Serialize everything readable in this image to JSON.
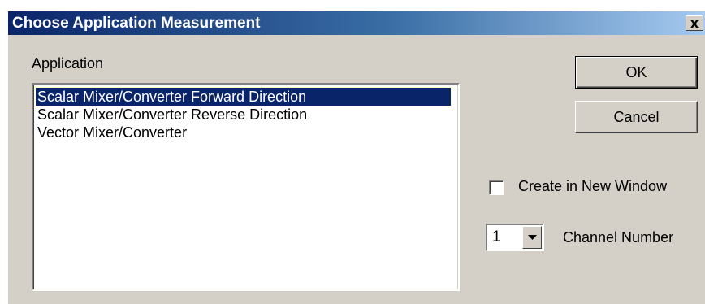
{
  "dialog": {
    "title": "Choose Application Measurement",
    "close_glyph": "x",
    "close_icon": "close-icon"
  },
  "application": {
    "label": "Application",
    "items": [
      "Scalar Mixer/Converter Forward Direction",
      "Scalar Mixer/Converter Reverse Direction",
      "Vector Mixer/Converter"
    ],
    "selected_index": 0
  },
  "buttons": {
    "ok": "OK",
    "cancel": "Cancel"
  },
  "options": {
    "create_new_window_label": "Create in New Window",
    "create_new_window_checked": false,
    "channel_number_value": "1",
    "channel_number_label": "Channel Number",
    "dropdown_icon": "chevron-down-icon"
  },
  "colors": {
    "dialog_bg": "#d4d0c8",
    "titlebar_start": "#0a246a",
    "titlebar_end": "#a6caf0",
    "selection_bg": "#0a246a"
  }
}
